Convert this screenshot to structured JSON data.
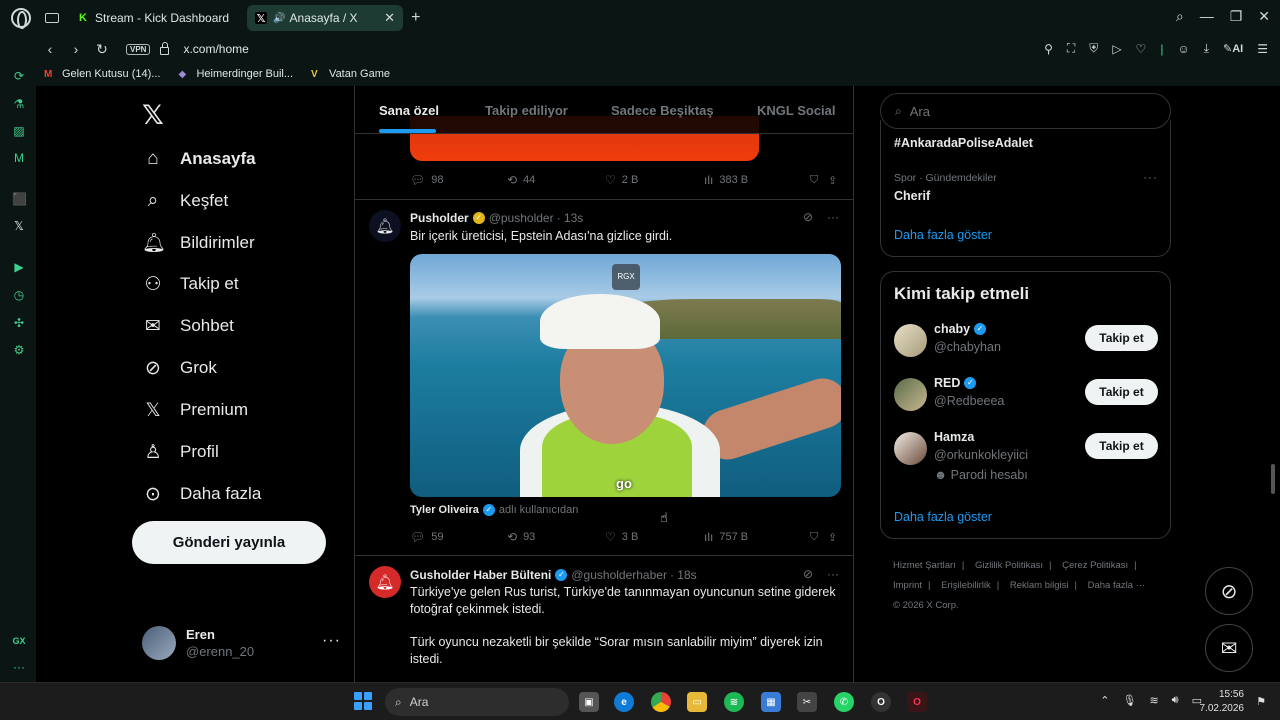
{
  "browser": {
    "tabs": [
      {
        "label": "Stream - Kick Dashboard"
      },
      {
        "label": "Anasayfa / X"
      }
    ],
    "url": "x.com/home",
    "vpn_label": "VPN",
    "ai_label": "AI",
    "bookmarks": [
      "Gelen Kutusu (14)...",
      "Heimerdinger Buil...",
      "Vatan Game"
    ],
    "gx_label": "GX"
  },
  "nav": {
    "items": [
      {
        "label": "Anasayfa",
        "icon": "home-icon"
      },
      {
        "label": "Keşfet",
        "icon": "search-icon"
      },
      {
        "label": "Bildirimler",
        "icon": "bell-icon"
      },
      {
        "label": "Takip et",
        "icon": "person-add-icon"
      },
      {
        "label": "Sohbet",
        "icon": "mail-icon"
      },
      {
        "label": "Grok",
        "icon": "grok-icon"
      },
      {
        "label": "Premium",
        "icon": "x-icon"
      },
      {
        "label": "Profil",
        "icon": "person-icon"
      },
      {
        "label": "Daha fazla",
        "icon": "more-circle-icon"
      }
    ],
    "post_button": "Gönderi yayınla",
    "user": {
      "name": "Eren",
      "handle": "@erenn_20"
    }
  },
  "feed": {
    "tabs": [
      "Sana özel",
      "Takip ediliyor",
      "Sadece Beşiktaş",
      "KNGL Social"
    ],
    "prev_post_stats": {
      "replies": "98",
      "reposts": "44",
      "likes": "2 B",
      "views": "383 B"
    },
    "post1": {
      "name": "Pusholder",
      "handle": "@pusholder",
      "time": "· 13s",
      "text": "Bir içerik üreticisi, Epstein Adası'na gizlice girdi.",
      "video_badge": "RGX",
      "video_subtitle": "go",
      "attribution_name": "Tyler Oliveira",
      "attribution_suffix": "adlı kullanıcıdan",
      "stats": {
        "replies": "59",
        "reposts": "93",
        "likes": "3 B",
        "views": "757 B"
      }
    },
    "post2": {
      "name": "Gusholder Haber Bülteni",
      "handle": "@gusholderhaber",
      "time": "· 18s",
      "text1": "Türkiye'ye gelen Rus turist, Türkiye'de tanınmayan oyuncunun setine giderek fotoğraf çekinmek istedi.",
      "text2": "Türk oyuncu nezaketli bir şekilde “Sorar mısın sanlabilir miyim” diyerek izin istedi."
    }
  },
  "right": {
    "search_placeholder": "Ara",
    "trend1": "#AnkaradaPoliseAdalet",
    "trend2_meta": "Spor · Gündemdekiler",
    "trend2": "Cherif",
    "show_more": "Daha fazla göster",
    "follow_title": "Kimi takip etmeli",
    "follow_button": "Takip et",
    "suggestions": [
      {
        "name": "chaby",
        "handle": "@chabyhan"
      },
      {
        "name": "RED",
        "handle": "@Redbeeea"
      },
      {
        "name": "Hamza",
        "handle": "@orkunkokleyiici",
        "note": "Parodi hesabı"
      }
    ],
    "footer": [
      "Hizmet Şartları",
      "Gizlilik Politikası",
      "Çerez Politikası",
      "Imprint",
      "Erişilebilirlik",
      "Reklam bilgisi",
      "Daha fazla ···",
      "© 2026 X Corp."
    ]
  },
  "taskbar": {
    "search": "Ara",
    "time": "15:56",
    "date": "7.02.2026"
  },
  "colors": {
    "accent": "#1d9bf0",
    "verified_gold": "#e2b719",
    "opera_green": "#3fcf8e",
    "chrome_bg": "#0b1614"
  }
}
